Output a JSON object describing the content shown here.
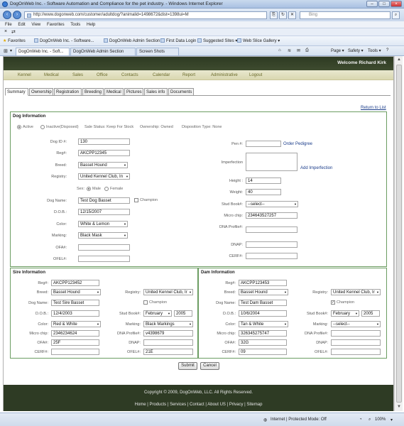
{
  "browser": {
    "window_title": "DogOnWeb Inc. - Software Automation and Compliance for the pet industry. - Windows Internet Explorer",
    "url": "http://www.dogonweb.com/customer/adultdog/?animalid=1498672&dist=1398ui=M",
    "search_placeholder": "Bing",
    "menu": [
      "File",
      "Edit",
      "View",
      "Favorites",
      "Tools",
      "Help"
    ],
    "favorites_label": "Favorites",
    "favorites": [
      "DogOnWeb Inc. - Software...",
      "DogOnWeb Admin Section",
      "First Data Login",
      "Suggested Sites ▾",
      "Web Slice Gallery ▾"
    ],
    "tabs": [
      "DogOnWeb Inc. - Soft...",
      "DogOnWeb Admin Section",
      "Screen Shots"
    ],
    "commands": [
      "Page ▾",
      "Safety ▾",
      "Tools ▾"
    ],
    "status": {
      "zone": "Internet | Protected Mode: Off",
      "zoom": "100%"
    }
  },
  "header": {
    "welcome": "Welcome Richard Kirk"
  },
  "topnav": [
    "Kennel",
    "Medical",
    "Sales",
    "Office",
    "Contacts",
    "Calendar",
    "Report",
    "Administrative",
    "Logout"
  ],
  "page_tabs": [
    "Summary",
    "Ownership",
    "Registration",
    "Breeding",
    "Medical",
    "Pictures",
    "Sales info",
    "Documents"
  ],
  "return_link": "Return to List",
  "dog": {
    "section_title": "Dog Information",
    "status_active": "Active",
    "status_inactive": "Inactive(Disposed)",
    "sale_status": "Sale Status: Keep For Stock",
    "ownership": "Ownership: Owned",
    "disposition": "Disposition Type: None",
    "labels": {
      "dog_id": "Dog ID #:",
      "reg": "Reg#:",
      "breed": "Breed:",
      "registry": "Registry:",
      "sex": "Sex:",
      "dog_name": "Dog Name:",
      "dob": "D.O.B.:",
      "color": "Color:",
      "marking": "Marking:",
      "ofa": "OFA#:",
      "ofel": "OFEL#:",
      "pen": "Pen #:",
      "imperfection": "Imperfection",
      "height": "Height :",
      "weight": "Weight:",
      "stud_book": "Stud Book#:",
      "micro_chip": "Micro chip:",
      "dna_profile": "DNA Profile#:",
      "dnap": "DNAP:",
      "cerf": "CERF#:"
    },
    "values": {
      "dog_id": "130",
      "reg": "AKCPP12345",
      "breed": "Basset Hound",
      "registry": "United Kennel Club, In",
      "sex_male": "Male",
      "sex_female": "Female",
      "dog_name": "Test Dog Basset",
      "champion": "Champion",
      "dob": "12/15/2007",
      "color": "White & Lemon",
      "marking": "Black Mask",
      "ofa": "",
      "ofel": "",
      "pen": "",
      "height": "14",
      "weight": "40",
      "stud_book": "--select--",
      "micro_chip": "234643527257",
      "dna_profile": "",
      "dnap": "",
      "cerf": ""
    },
    "order_pedigree": "Order Pedigree",
    "add_imperfection": "Add Imperfection"
  },
  "sire": {
    "section_title": "Sire Information",
    "labels": {
      "reg": "Reg#:",
      "breed": "Breed:",
      "registry": "Registry:",
      "dog_name": "Dog Name:",
      "dob": "D.O.B.:",
      "stud_book": "Stud Book#:",
      "color": "Color:",
      "marking": "Marking:",
      "micro_chip": "Micro chip:",
      "dna_profile": "DNA Profile#:",
      "ofa": "OFA#:",
      "dnap": "DNAP:",
      "cerf": "CERF#:",
      "ofel": "OFEL#:"
    },
    "values": {
      "reg": "AKCPP123452",
      "breed": "Basset Hound",
      "registry": "United Kennel Club, Ir",
      "dog_name": "Test Sire Basset",
      "champion": "Champion",
      "dob": "12/4/2003",
      "stud_month": "February",
      "stud_year": "2005",
      "color": "Red & White",
      "marking": "Black Markings",
      "micro_chip": "2346234624",
      "dna_profile": "v4398679",
      "ofa": "25F",
      "dnap": "",
      "cerf": "",
      "ofel": "21E"
    }
  },
  "dam": {
    "section_title": "Dam Information",
    "labels": {
      "reg": "Reg#:",
      "breed": "Breed:",
      "registry": "Registry:",
      "dog_name": "Dog Name:",
      "dob": "D.O.B.:",
      "stud_book": "Stud Book#:",
      "color": "Color:",
      "marking": "Marking:",
      "micro_chip": "Micro chip:",
      "dna_profile": "DNA Profile#:",
      "ofa": "OFA#:",
      "dnap": "DNAP:",
      "cerf": "CERF#:",
      "ofel": "OFEL#:"
    },
    "values": {
      "reg": "AKCPP123453",
      "breed": "Basset Hound",
      "registry": "United Kennel Club, Ir",
      "dog_name": "Test Dam Basset",
      "champion": "Champion",
      "dob": "10/6/2004",
      "stud_month": "February",
      "stud_year": "2005",
      "color": "Tan & White",
      "marking": "--select--",
      "micro_chip": "326345275747",
      "dna_profile": "",
      "ofa": "32G",
      "dnap": "",
      "cerf": "09",
      "ofel": ""
    }
  },
  "actions": {
    "submit": "Submit",
    "cancel": "Cancel"
  },
  "footer": {
    "copyright": "Copyright © 2009, DogOnWeb, LLC.  All Rights Reserved.",
    "links": [
      "Home",
      "Products",
      "Services",
      "Contact",
      "About US",
      "Privacy",
      "Sitemap"
    ]
  }
}
